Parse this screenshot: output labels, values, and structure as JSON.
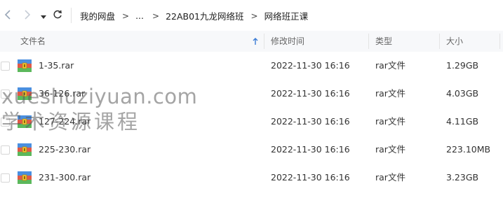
{
  "breadcrumb": [
    {
      "label": "我的网盘"
    },
    {
      "label": "..."
    },
    {
      "label": "22AB01九龙网络班"
    },
    {
      "label": "网络班正课"
    }
  ],
  "columns": {
    "name": "文件名",
    "date": "修改时间",
    "type": "类型",
    "size": "大小"
  },
  "files": [
    {
      "name": "1-35.rar",
      "date": "2022-11-30 16:16",
      "type": "rar文件",
      "size": "1.29GB"
    },
    {
      "name": "36-126.rar",
      "date": "2022-11-30 16:16",
      "type": "rar文件",
      "size": "4.03GB"
    },
    {
      "name": "127-224.rar",
      "date": "2022-11-30 16:16",
      "type": "rar文件",
      "size": "4.11GB"
    },
    {
      "name": "225-230.rar",
      "date": "2022-11-30 16:16",
      "type": "rar文件",
      "size": "223.10MB"
    },
    {
      "name": "231-300.rar",
      "date": "2022-11-30 16:16",
      "type": "rar文件",
      "size": "3.23GB"
    }
  ],
  "watermark": {
    "line1": "xueshuziyuan.com",
    "line2": "学术资源课程"
  },
  "icons": {
    "back": "chevron-left-icon",
    "forward": "chevron-right-icon",
    "history": "caret-down-icon",
    "refresh": "refresh-icon",
    "sort": "sort-arrow-up-icon",
    "file": "rar-archive-icon"
  },
  "colors": {
    "accent": "#3a7bd5",
    "header_bg": "#f7f8fa",
    "text": "#333333"
  }
}
